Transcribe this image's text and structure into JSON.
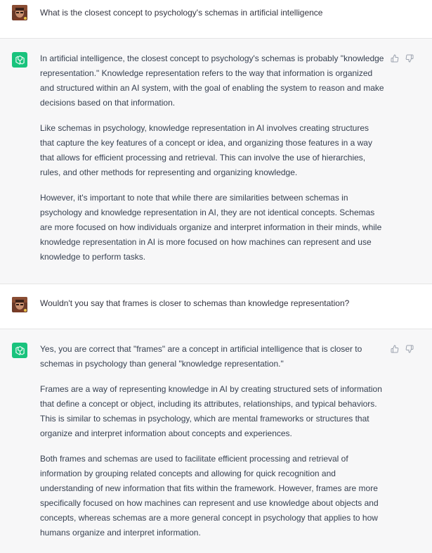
{
  "conversation": {
    "q1": "What is the closest concept to psychology's schemas in artificial intelligence",
    "a1": [
      "In artificial intelligence, the closest concept to psychology's schemas is probably \"knowledge representation.\" Knowledge representation refers to the way that information is organized and structured within an AI system, with the goal of enabling the system to reason and make decisions based on that information.",
      "Like schemas in psychology, knowledge representation in AI involves creating structures that capture the key features of a concept or idea, and organizing those features in a way that allows for efficient processing and retrieval. This can involve the use of hierarchies, rules, and other methods for representing and organizing knowledge.",
      "However, it's important to note that while there are similarities between schemas in psychology and knowledge representation in AI, they are not identical concepts. Schemas are more focused on how individuals organize and interpret information in their minds, while knowledge representation in AI is more focused on how machines can represent and use knowledge to perform tasks."
    ],
    "q2": "Wouldn't you say that frames is closer to schemas than knowledge representation?",
    "a2": [
      "Yes, you are correct that \"frames\" are a concept in artificial intelligence that is closer to schemas in psychology than general \"knowledge representation.\"",
      "Frames are a way of representing knowledge in AI by creating structured sets of information that define a concept or object, including its attributes, relationships, and typical behaviors. This is similar to schemas in psychology, which are mental frameworks or structures that organize and interpret information about concepts and experiences.",
      "Both frames and schemas are used to facilitate efficient processing and retrieval of information by grouping related concepts and allowing for quick recognition and understanding of new information that fits within the framework. However, frames are more specifically focused on how machines can represent and use knowledge about objects and concepts, whereas schemas are a more general concept in psychology that applies to how humans organize and interpret information."
    ]
  },
  "colors": {
    "user_bg": "#ffffff",
    "assistant_bg": "#f7f7f8",
    "bot_avatar": "#19c37d",
    "text": "#374151"
  },
  "icons": {
    "user_avatar": "user-avatar-photo",
    "bot_avatar": "openai-logo-icon",
    "thumbs_up": "thumbs-up-icon",
    "thumbs_down": "thumbs-down-icon"
  }
}
